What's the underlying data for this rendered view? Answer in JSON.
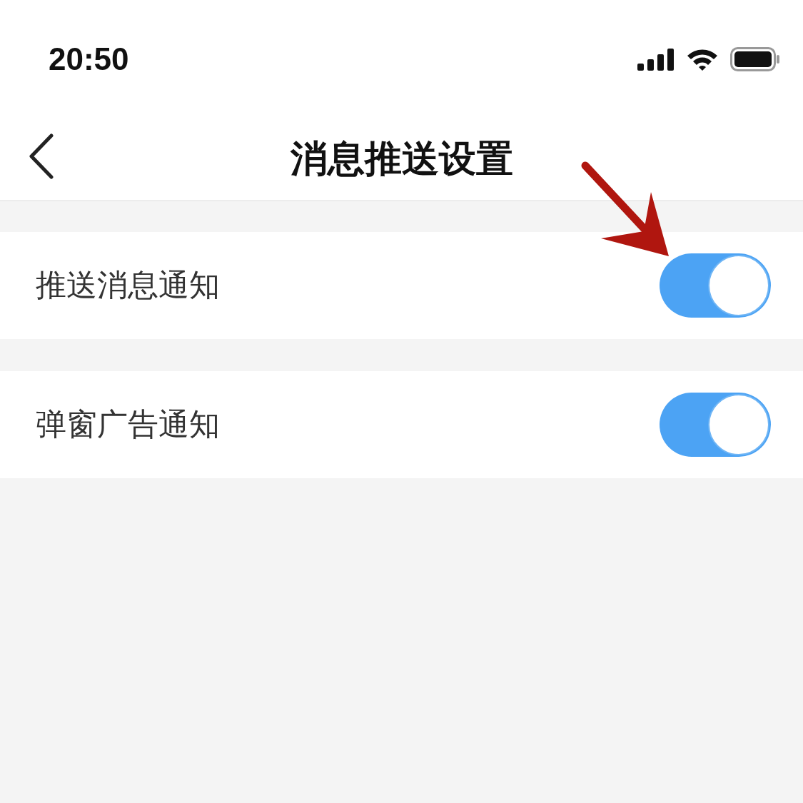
{
  "status_bar": {
    "time": "20:50"
  },
  "nav": {
    "title": "消息推送设置"
  },
  "settings": [
    {
      "label": "推送消息通知",
      "on": true
    },
    {
      "label": "弹窗广告通知",
      "on": true
    }
  ]
}
